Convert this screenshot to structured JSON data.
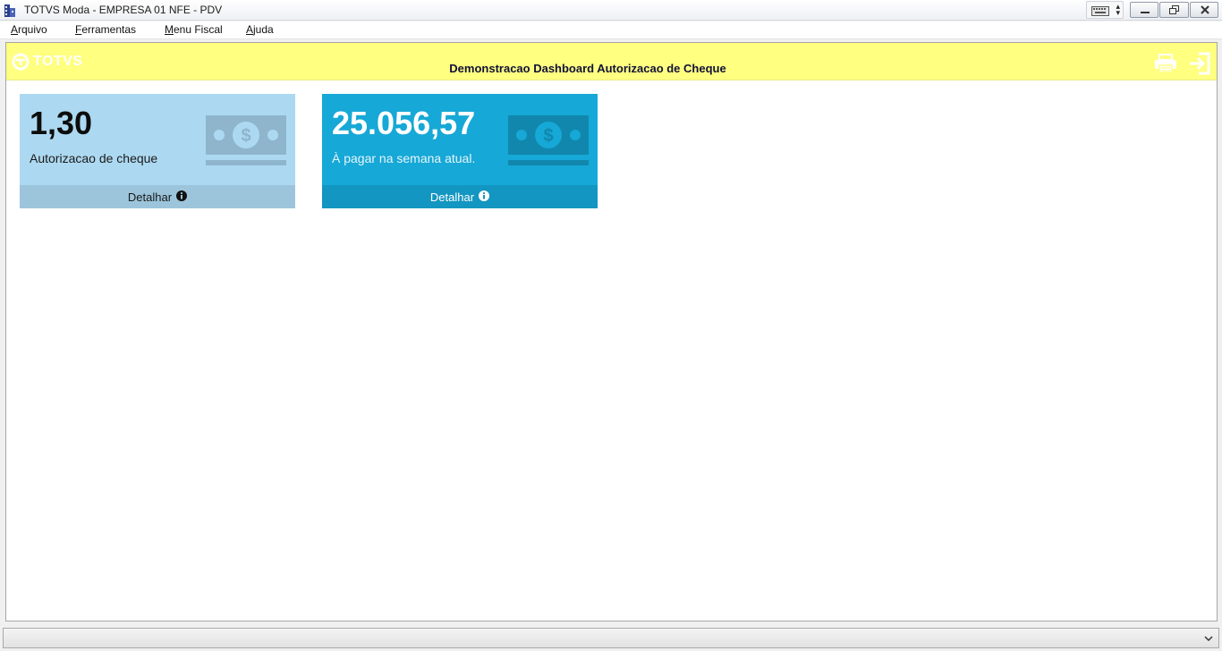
{
  "window": {
    "title": "TOTVS Moda - EMPRESA 01 NFE - PDV",
    "app_icon": "building-icon",
    "controls": [
      "minimize-icon",
      "restore-icon",
      "close-icon"
    ]
  },
  "menu": {
    "items": [
      {
        "underline": "A",
        "rest": "rquivo"
      },
      {
        "underline": "F",
        "rest": "erramentas"
      },
      {
        "underline": "M",
        "rest": "enu Fiscal"
      },
      {
        "underline": "A",
        "rest": "juda"
      }
    ]
  },
  "header": {
    "logo_text": "TOTVS",
    "title": "Demonstracao Dashboard Autorizacao de Cheque",
    "color": "#ffff80"
  },
  "cards": [
    {
      "value": "1,30",
      "label": "Autorizacao de cheque",
      "footer": "Detalhar",
      "icon": "money-bill-icon",
      "color": "#acd9f1"
    },
    {
      "value": "25.056,57",
      "label": "À pagar na semana atual.",
      "footer": "Detalhar",
      "icon": "money-bill-icon",
      "color": "#16a8d6"
    }
  ]
}
